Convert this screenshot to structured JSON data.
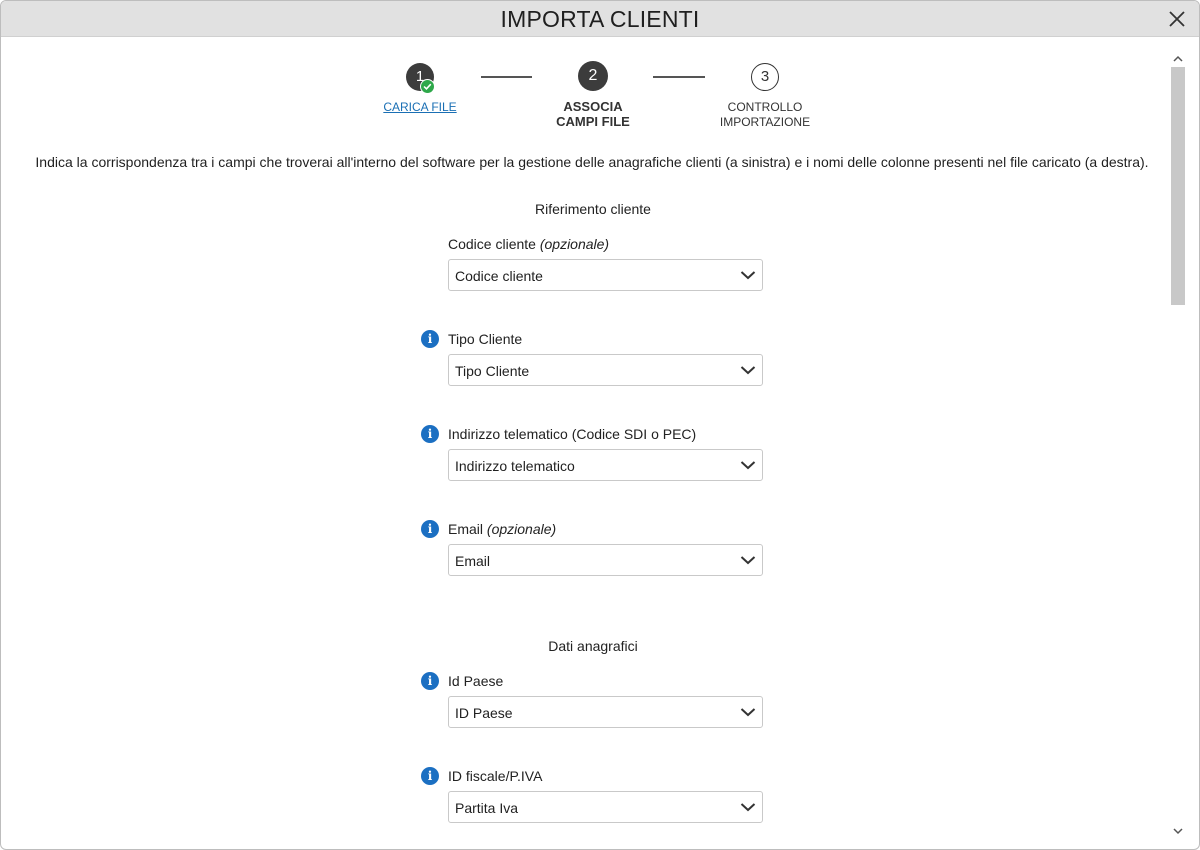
{
  "dialog": {
    "title": "IMPORTA CLIENTI",
    "close_icon": "close-icon"
  },
  "stepper": {
    "steps": [
      {
        "number": "1",
        "label": "CARICA FILE",
        "state": "completed"
      },
      {
        "number": "2",
        "label_line1": "ASSOCIA",
        "label_line2": "CAMPI FILE",
        "state": "active"
      },
      {
        "number": "3",
        "label_line1": "CONTROLLO",
        "label_line2": "IMPORTAZIONE",
        "state": "pending"
      }
    ]
  },
  "intro_text": "Indica la corrispondenza tra i campi che troverai all'interno del software per la gestione delle anagrafiche clienti (a sinistra) e i nomi delle colonne presenti nel file caricato (a destra).",
  "sections": {
    "riferimento": {
      "title": "Riferimento cliente",
      "fields": [
        {
          "label": "Codice cliente",
          "label_suffix": "(opzionale)",
          "value": "Codice cliente",
          "info": false
        },
        {
          "label": "Tipo Cliente",
          "label_suffix": "",
          "value": "Tipo Cliente",
          "info": true
        },
        {
          "label": "Indirizzo telematico (Codice SDI o PEC)",
          "label_suffix": "",
          "value": "Indirizzo telematico",
          "info": true
        },
        {
          "label": "Email",
          "label_suffix": "(opzionale)",
          "value": "Email",
          "info": true
        }
      ]
    },
    "anagrafici": {
      "title": "Dati anagrafici",
      "fields": [
        {
          "label": "Id Paese",
          "label_suffix": "",
          "value": "ID Paese",
          "info": true
        },
        {
          "label": "ID fiscale/P.IVA",
          "label_suffix": "",
          "value": "Partita Iva",
          "info": true
        }
      ]
    }
  },
  "icons": {
    "info": "i",
    "chevron": "chevron-down-icon",
    "check": "check-icon"
  },
  "colors": {
    "titlebar_bg": "#e1e1e1",
    "step_dark": "#3c3c3c",
    "check_green": "#2ea84a",
    "info_blue": "#1b6fc2",
    "link_blue": "#1a6fb4"
  }
}
